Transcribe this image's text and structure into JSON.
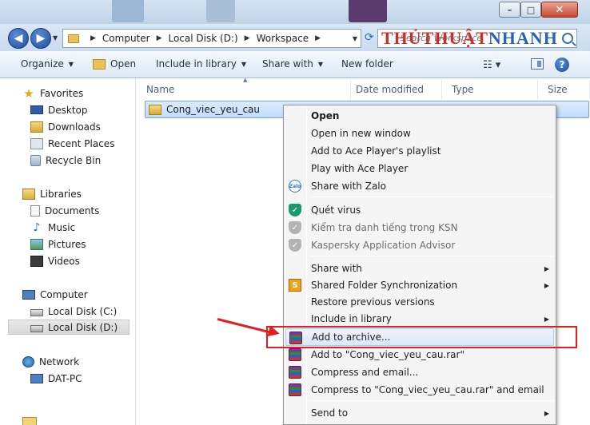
{
  "window": {
    "controls": {
      "minimize": "–",
      "maximize": "□",
      "close": "✕"
    }
  },
  "navigation": {
    "back_glyph": "◀",
    "forward_glyph": "▶",
    "breadcrumb": [
      "Computer",
      "Local Disk (D:)",
      "Workspace"
    ],
    "search_placeholder": "Search Workspace",
    "watermark_part1": "THỦTHUẬT",
    "watermark_part2": "NHANH"
  },
  "toolbar": {
    "organize": "Organize",
    "open": "Open",
    "include_in_library": "Include in library",
    "share_with": "Share with",
    "new_folder": "New folder",
    "help": "?"
  },
  "nav_pane": {
    "favorites": "Favorites",
    "desktop": "Desktop",
    "downloads": "Downloads",
    "recent_places": "Recent Places",
    "recycle_bin": "Recycle Bin",
    "libraries": "Libraries",
    "documents": "Documents",
    "music": "Music",
    "pictures": "Pictures",
    "videos": "Videos",
    "computer": "Computer",
    "local_disk_c": "Local Disk (C:)",
    "local_disk_d": "Local Disk (D:)",
    "network": "Network",
    "dat_pc": "DAT-PC"
  },
  "file_list": {
    "columns": {
      "name": "Name",
      "date_modified": "Date modified",
      "type": "Type",
      "size": "Size"
    },
    "rows": [
      {
        "name": "Cong_viec_yeu_cau"
      }
    ]
  },
  "context_menu": {
    "items": [
      {
        "label": "Open"
      },
      {
        "label": "Open in new window"
      },
      {
        "label": "Add to Ace Player's playlist"
      },
      {
        "label": "Play with Ace Player"
      },
      {
        "label": "Share with Zalo",
        "icon_text": "Zalo"
      },
      {
        "label": "Quét virus"
      },
      {
        "label": "Kiểm tra danh tiếng trong KSN"
      },
      {
        "label": "Kaspersky Application Advisor"
      },
      {
        "label": "Share with"
      },
      {
        "label": "Shared Folder Synchronization"
      },
      {
        "label": "Restore previous versions"
      },
      {
        "label": "Include in library"
      },
      {
        "label": "Add to archive..."
      },
      {
        "label": "Add to \"Cong_viec_yeu_cau.rar\""
      },
      {
        "label": "Compress and email..."
      },
      {
        "label": "Compress to \"Cong_viec_yeu_cau.rar\" and email"
      },
      {
        "label": "Send to"
      }
    ]
  },
  "colors": {
    "annotation": "#e31e1e",
    "selection": "#c1dbfc",
    "window_chrome": "#c9dbee"
  }
}
